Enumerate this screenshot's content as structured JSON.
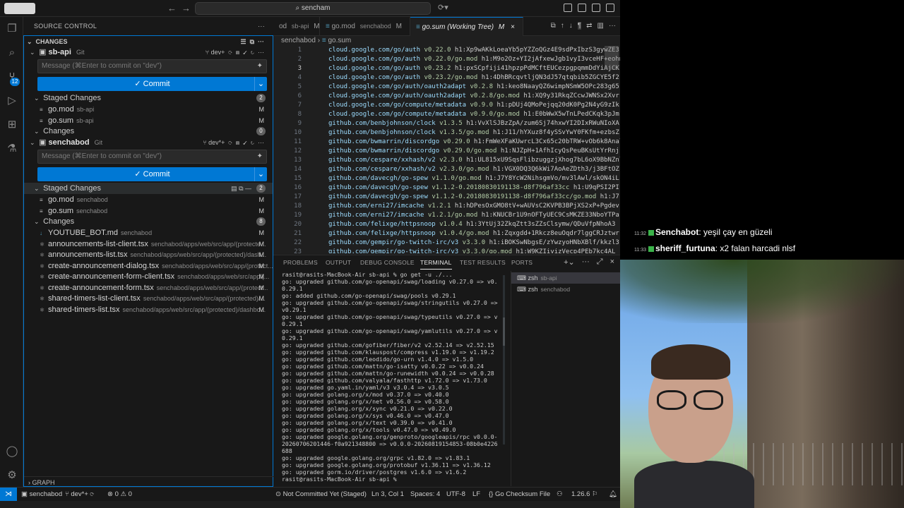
{
  "titlebar": {
    "search": "sencham",
    "back": "←",
    "forward": "→"
  },
  "activity": {
    "scm_badge": "12"
  },
  "sidebar": {
    "title": "SOURCE CONTROL",
    "section": "CHANGES",
    "graph": "GRAPH",
    "repos": [
      {
        "name": "sb-api",
        "vcs": "Git",
        "branch": "dev+",
        "message_placeholder": "Message (⌘Enter to commit on \"dev\")",
        "commit_label": "✓ Commit",
        "staged_label": "Staged Changes",
        "staged_count": "2",
        "staged": [
          {
            "name": "go.mod",
            "path": "sb-api",
            "status": "M"
          },
          {
            "name": "go.sum",
            "path": "sb-api",
            "status": "M"
          }
        ],
        "changes_label": "Changes",
        "changes_count": "0"
      },
      {
        "name": "senchabod",
        "vcs": "Git",
        "branch": "dev*+",
        "message_placeholder": "Message (⌘Enter to commit on \"dev\")",
        "commit_label": "✓ Commit",
        "staged_label": "Staged Changes",
        "staged_count": "2",
        "staged": [
          {
            "name": "go.mod",
            "path": "senchabod",
            "status": "M"
          },
          {
            "name": "go.sum",
            "path": "senchabod",
            "status": "M"
          }
        ],
        "changes_label": "Changes",
        "changes_count": "8",
        "changes": [
          {
            "name": "YOUTUBE_BOT.md",
            "path": "senchabod",
            "status": "M"
          },
          {
            "name": "announcements-list-client.tsx",
            "path": "senchabod/apps/web/src/app/(protecte...",
            "status": "M"
          },
          {
            "name": "announcements-list.tsx",
            "path": "senchabod/apps/web/src/app/(protected)/dash...",
            "status": "M"
          },
          {
            "name": "create-announcement-dialog.tsx",
            "path": "senchabod/apps/web/src/app/(protect...",
            "status": "M"
          },
          {
            "name": "create-announcement-form-client.tsx",
            "path": "senchabod/apps/web/src/app/(...",
            "status": "M"
          },
          {
            "name": "create-announcement-form.tsx",
            "path": "senchabod/apps/web/src/app/(protect...",
            "status": "M"
          },
          {
            "name": "shared-timers-list-client.tsx",
            "path": "senchabod/apps/web/src/app/(protected)/...",
            "status": "M"
          },
          {
            "name": "shared-timers-list.tsx",
            "path": "senchabod/apps/web/src/app/(protected)/dashbo...",
            "status": "M"
          }
        ]
      }
    ]
  },
  "editor": {
    "tabs": [
      {
        "label": "od",
        "sub": "sb-api",
        "flag": "M"
      },
      {
        "label": "go.mod",
        "sub": "senchabod",
        "flag": "M"
      },
      {
        "label": "go.sum (Working Tree)",
        "sub": "",
        "flag": "M"
      }
    ],
    "breadcrumb": [
      "senchabod",
      "go.sum"
    ],
    "lines": [
      {
        "mod": "cloud.google.com/go/auth",
        "ver": "v0.22.0",
        "hash": "h1:Xp9wAKkLoeaYb5pYZZoQGz4E9sdPxIbzS3gywZE3"
      },
      {
        "mod": "cloud.google.com/go/auth",
        "ver": "v0.22.0/go.mod",
        "hash": "h1:M9o2Oz+YI2jAfxewJgb1vyI3vceHF+eohm"
      },
      {
        "mod": "cloud.google.com/go/auth",
        "ver": "v0.23.2",
        "hash": "h1:pxSCpfiji41hpzpPdMCftEUCezpgpqmmDdYiAjCK"
      },
      {
        "mod": "cloud.google.com/go/auth",
        "ver": "v0.23.2/go.mod",
        "hash": "h1:4DhBRcqvtljQN3dJ57qtqbib5ZGCYE5f2"
      },
      {
        "mod": "cloud.google.com/go/auth/oauth2adapt",
        "ver": "v0.2.8",
        "hash": "h1:keo8NaayQZ6wimpNSmW5OPc283g65"
      },
      {
        "mod": "cloud.google.com/go/auth/oauth2adapt",
        "ver": "v0.2.8/go.mod",
        "hash": "h1:XQ9y31RkqZCcwJWNSx2Xvr"
      },
      {
        "mod": "cloud.google.com/go/compute/metadata",
        "ver": "v0.9.0",
        "hash": "h1:pDUj4QMoPejqq20dK0Pg2N4yG9zIk"
      },
      {
        "mod": "cloud.google.com/go/compute/metadata",
        "ver": "v0.9.0/go.mod",
        "hash": "h1:E0bWwX5wTnLPedCKqk3pJm"
      },
      {
        "mod": "github.com/benbjohnson/clock",
        "ver": "v1.3.5",
        "hash": "h1:VvXlSJBzZpA/zum6Sj74hxwYI2DIxRWuNIoXA"
      },
      {
        "mod": "github.com/benbjohnson/clock",
        "ver": "v1.3.5/go.mod",
        "hash": "h1:J11/hYXuz8f4ySSvYwY0FKfm+ezbsZ"
      },
      {
        "mod": "github.com/bwmarrin/discordgo",
        "ver": "v0.29.0",
        "hash": "h1:FmWeXFaKUwrcL3Cx65c20bTRW+vOb6k8Anal"
      },
      {
        "mod": "github.com/bwmarrin/discordgo",
        "ver": "v0.29.0/go.mod",
        "hash": "h1:NJZpH+1AfhIcyQsPeuBKsUtYrRnj"
      },
      {
        "mod": "github.com/cespare/xxhash/v2",
        "ver": "v2.3.0",
        "hash": "h1:UL815xU9SqsFlibzuggzjXhog7bL6oX9BbNZnl"
      },
      {
        "mod": "github.com/cespare/xxhash/v2",
        "ver": "v2.3.0/go.mod",
        "hash": "h1:VGX0DQ3Q6kWi7AoAeZDth3/j3BFtOZ"
      },
      {
        "mod": "github.com/davecgh/go-spew",
        "ver": "v1.1.0/go.mod",
        "hash": "h1:J7Y8YcW2NihsgmVo/mv3lAwl/skON4iL"
      },
      {
        "mod": "github.com/davecgh/go-spew",
        "ver": "v1.1.2-0.20180830191138-d8f796af33cc",
        "hash": "h1:U9qPSI2PI"
      },
      {
        "mod": "github.com/davecgh/go-spew",
        "ver": "v1.1.2-0.20180830191138-d8f796af33cc/go.mod",
        "hash": "h1:J7"
      },
      {
        "mod": "github.com/erni27/imcache",
        "ver": "v1.2.1",
        "hash": "h1:hDPesOxGMO8tV+wAUVsC2KVPB3BPjXS2xP+Pgdev"
      },
      {
        "mod": "github.com/erni27/imcache",
        "ver": "v1.2.1/go.mod",
        "hash": "h1:KNUCBr1U9nOFTyUEC9CsMKZE33NboYTPa"
      },
      {
        "mod": "github.com/felixge/httpsnoop",
        "ver": "v1.0.4",
        "hash": "h1:3YtUj32ZkqZtt3sZZsClsymw/QDuVfpNhoA3"
      },
      {
        "mod": "github.com/felixge/httpsnoop",
        "ver": "v1.0.4/go.mod",
        "hash": "h1:Zqxgdd+1Rkcz8euOqdr7lggCRJztwr"
      },
      {
        "mod": "github.com/gempir/go-twitch-irc/v3",
        "ver": "v3.3.0",
        "hash": "h1:iBOKSwNbgsE/zYwzyoHNbXBlf/kkzl3"
      },
      {
        "mod": "github.com/gempir/go-twitch-irc/v3",
        "ver": "v3.3.0/go.mod",
        "hash": "h1:W9KZIiyizVecp4PEb7kc4AL"
      }
    ]
  },
  "panel": {
    "tabs": [
      "PROBLEMS",
      "OUTPUT",
      "DEBUG CONSOLE",
      "TERMINAL",
      "TEST RESULTS",
      "PORTS"
    ],
    "terminal_lines": [
      "rasit@rasits-MacBook-Air sb-api % go get -u ./...",
      "go: upgraded github.com/go-openapi/swag/loading v0.27.0 => v0.",
      "0.29.1",
      "go: added github.com/go-openapi/swag/pools v0.29.1",
      "go: upgraded github.com/go-openapi/swag/stringutils v0.27.0 =>",
      " v0.29.1",
      "go: upgraded github.com/go-openapi/swag/typeutils v0.27.0 => v",
      "0.29.1",
      "go: upgraded github.com/go-openapi/swag/yamlutils v0.27.0 => v",
      "0.29.1",
      "go: upgraded github.com/gofiber/fiber/v2 v2.52.14 => v2.52.15",
      "go: upgraded github.com/klauspost/compress v1.19.0 => v1.19.2",
      "go: upgraded github.com/leodido/go-urn v1.4.0 => v1.5.0",
      "go: upgraded github.com/mattn/go-isatty v0.0.22 => v0.0.24",
      "go: upgraded github.com/mattn/go-runewidth v0.0.24 => v0.0.28",
      "go: upgraded github.com/valyala/fasthttp v1.72.0 => v1.73.0",
      "go: upgraded go.yaml.in/yaml/v3 v3.0.4 => v3.0.5",
      "go: upgraded golang.org/x/mod v0.37.0 => v0.40.0",
      "go: upgraded golang.org/x/net v0.56.0 => v0.58.0",
      "go: upgraded golang.org/x/sync v0.21.0 => v0.22.0",
      "go: upgraded golang.org/x/sys v0.46.0 => v0.47.0",
      "go: upgraded golang.org/x/text v0.39.0 => v0.41.0",
      "go: upgraded golang.org/x/tools v0.47.0 => v0.49.0",
      "go: upgraded google.golang.org/genproto/googleapis/rpc v0.0.0-",
      "20260706201446-f0a921348800 => v0.0.0-20260819154853-08b0e4226",
      "688",
      "go: upgraded google.golang.org/grpc v1.82.0 => v1.83.1",
      "go: upgraded google.golang.org/protobuf v1.36.11 => v1.36.12",
      "go: upgraded gorm.io/driver/postgres v1.6.0 => v1.6.2",
      "rasit@rasits-MacBook-Air sb-api % "
    ],
    "terminals": [
      {
        "shell": "zsh",
        "name": "sb-api"
      },
      {
        "shell": "zsh",
        "name": "senchabod"
      }
    ]
  },
  "statusbar": {
    "repo": "senchabod",
    "branch": "dev*+",
    "problems": "⊗ 0 ⚠ 0",
    "commit_state": "Not Committed Yet (Staged)",
    "cursor": "Ln 3, Col 1",
    "spaces": "Spaces: 4",
    "encoding": "UTF-8",
    "eol": "LF",
    "language": "Go Checksum File",
    "go_version": "1.26.6"
  },
  "chat": [
    {
      "time": "11:32",
      "user": "Senchabot",
      "text": ": yeşil çay en güzeli"
    },
    {
      "time": "11:33",
      "user": "sheriff_furtuna",
      "text": ": x2 falan harcadi nlsf"
    }
  ]
}
